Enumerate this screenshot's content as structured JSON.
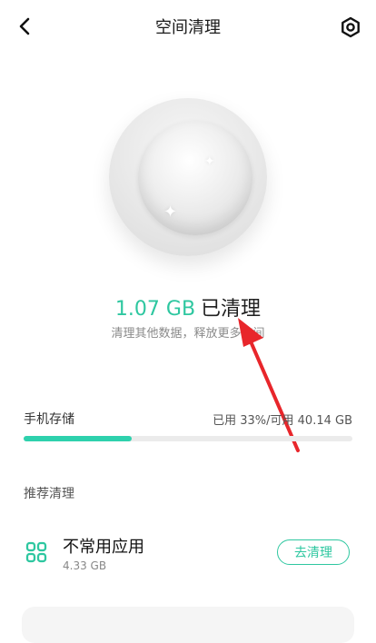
{
  "header": {
    "title": "空间清理",
    "back_icon": "chevron-left-icon",
    "settings_icon": "gear-icon"
  },
  "summary": {
    "cleaned_amount": "1.07 GB",
    "cleaned_text": "已清理",
    "subtitle": "清理其他数据，释放更多空间"
  },
  "storage": {
    "label": "手机存储",
    "usage": "已用 33%/可用 40.14 GB",
    "used_fraction": 0.33,
    "fill_color": "#2ed1ad"
  },
  "recommend": {
    "section_title": "推荐清理",
    "items": [
      {
        "icon": "apps-grid-icon",
        "name": "不常用应用",
        "size": "4.33 GB",
        "action_label": "去清理"
      }
    ]
  },
  "colors": {
    "accent": "#2ec7a0",
    "annotation_arrow": "#e8262b"
  }
}
